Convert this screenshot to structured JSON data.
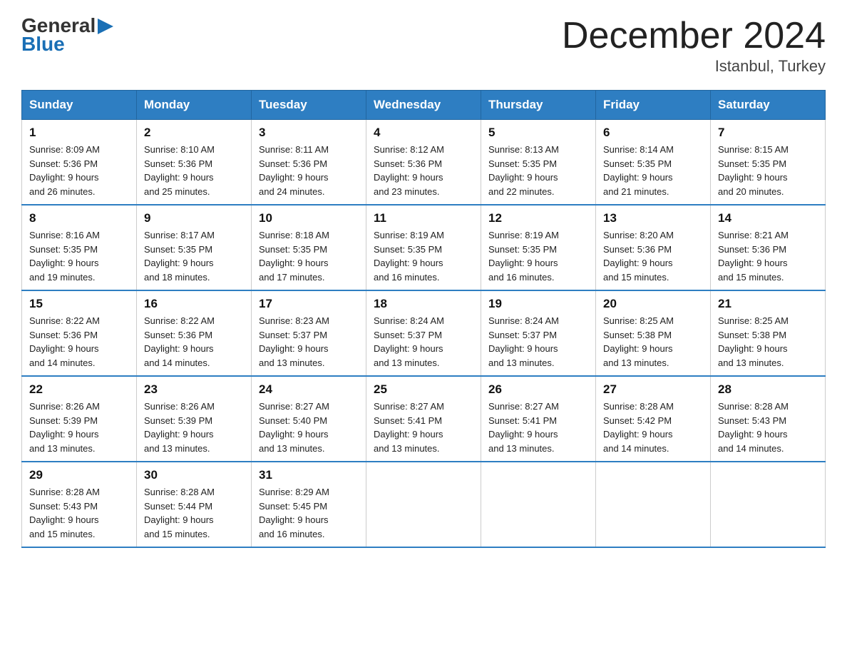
{
  "logo": {
    "general": "General",
    "arrow": "▶",
    "blue": "Blue"
  },
  "title": "December 2024",
  "location": "Istanbul, Turkey",
  "days_of_week": [
    "Sunday",
    "Monday",
    "Tuesday",
    "Wednesday",
    "Thursday",
    "Friday",
    "Saturday"
  ],
  "weeks": [
    [
      {
        "day": "1",
        "sunrise": "8:09 AM",
        "sunset": "5:36 PM",
        "daylight": "9 hours and 26 minutes."
      },
      {
        "day": "2",
        "sunrise": "8:10 AM",
        "sunset": "5:36 PM",
        "daylight": "9 hours and 25 minutes."
      },
      {
        "day": "3",
        "sunrise": "8:11 AM",
        "sunset": "5:36 PM",
        "daylight": "9 hours and 24 minutes."
      },
      {
        "day": "4",
        "sunrise": "8:12 AM",
        "sunset": "5:36 PM",
        "daylight": "9 hours and 23 minutes."
      },
      {
        "day": "5",
        "sunrise": "8:13 AM",
        "sunset": "5:35 PM",
        "daylight": "9 hours and 22 minutes."
      },
      {
        "day": "6",
        "sunrise": "8:14 AM",
        "sunset": "5:35 PM",
        "daylight": "9 hours and 21 minutes."
      },
      {
        "day": "7",
        "sunrise": "8:15 AM",
        "sunset": "5:35 PM",
        "daylight": "9 hours and 20 minutes."
      }
    ],
    [
      {
        "day": "8",
        "sunrise": "8:16 AM",
        "sunset": "5:35 PM",
        "daylight": "9 hours and 19 minutes."
      },
      {
        "day": "9",
        "sunrise": "8:17 AM",
        "sunset": "5:35 PM",
        "daylight": "9 hours and 18 minutes."
      },
      {
        "day": "10",
        "sunrise": "8:18 AM",
        "sunset": "5:35 PM",
        "daylight": "9 hours and 17 minutes."
      },
      {
        "day": "11",
        "sunrise": "8:19 AM",
        "sunset": "5:35 PM",
        "daylight": "9 hours and 16 minutes."
      },
      {
        "day": "12",
        "sunrise": "8:19 AM",
        "sunset": "5:35 PM",
        "daylight": "9 hours and 16 minutes."
      },
      {
        "day": "13",
        "sunrise": "8:20 AM",
        "sunset": "5:36 PM",
        "daylight": "9 hours and 15 minutes."
      },
      {
        "day": "14",
        "sunrise": "8:21 AM",
        "sunset": "5:36 PM",
        "daylight": "9 hours and 15 minutes."
      }
    ],
    [
      {
        "day": "15",
        "sunrise": "8:22 AM",
        "sunset": "5:36 PM",
        "daylight": "9 hours and 14 minutes."
      },
      {
        "day": "16",
        "sunrise": "8:22 AM",
        "sunset": "5:36 PM",
        "daylight": "9 hours and 14 minutes."
      },
      {
        "day": "17",
        "sunrise": "8:23 AM",
        "sunset": "5:37 PM",
        "daylight": "9 hours and 13 minutes."
      },
      {
        "day": "18",
        "sunrise": "8:24 AM",
        "sunset": "5:37 PM",
        "daylight": "9 hours and 13 minutes."
      },
      {
        "day": "19",
        "sunrise": "8:24 AM",
        "sunset": "5:37 PM",
        "daylight": "9 hours and 13 minutes."
      },
      {
        "day": "20",
        "sunrise": "8:25 AM",
        "sunset": "5:38 PM",
        "daylight": "9 hours and 13 minutes."
      },
      {
        "day": "21",
        "sunrise": "8:25 AM",
        "sunset": "5:38 PM",
        "daylight": "9 hours and 13 minutes."
      }
    ],
    [
      {
        "day": "22",
        "sunrise": "8:26 AM",
        "sunset": "5:39 PM",
        "daylight": "9 hours and 13 minutes."
      },
      {
        "day": "23",
        "sunrise": "8:26 AM",
        "sunset": "5:39 PM",
        "daylight": "9 hours and 13 minutes."
      },
      {
        "day": "24",
        "sunrise": "8:27 AM",
        "sunset": "5:40 PM",
        "daylight": "9 hours and 13 minutes."
      },
      {
        "day": "25",
        "sunrise": "8:27 AM",
        "sunset": "5:41 PM",
        "daylight": "9 hours and 13 minutes."
      },
      {
        "day": "26",
        "sunrise": "8:27 AM",
        "sunset": "5:41 PM",
        "daylight": "9 hours and 13 minutes."
      },
      {
        "day": "27",
        "sunrise": "8:28 AM",
        "sunset": "5:42 PM",
        "daylight": "9 hours and 14 minutes."
      },
      {
        "day": "28",
        "sunrise": "8:28 AM",
        "sunset": "5:43 PM",
        "daylight": "9 hours and 14 minutes."
      }
    ],
    [
      {
        "day": "29",
        "sunrise": "8:28 AM",
        "sunset": "5:43 PM",
        "daylight": "9 hours and 15 minutes."
      },
      {
        "day": "30",
        "sunrise": "8:28 AM",
        "sunset": "5:44 PM",
        "daylight": "9 hours and 15 minutes."
      },
      {
        "day": "31",
        "sunrise": "8:29 AM",
        "sunset": "5:45 PM",
        "daylight": "9 hours and 16 minutes."
      },
      null,
      null,
      null,
      null
    ]
  ]
}
